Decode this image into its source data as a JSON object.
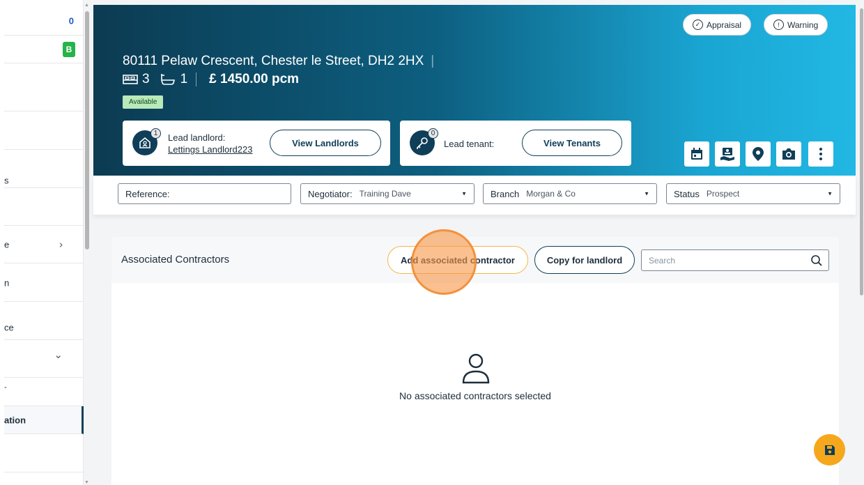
{
  "sidebar": {
    "items": [
      {
        "label": "",
        "count": "0"
      },
      {
        "label": "",
        "badge": "B"
      },
      {
        "label": ""
      },
      {
        "label": ""
      },
      {
        "label": "s"
      },
      {
        "label": "",
        "chevron": "›"
      },
      {
        "label": "e"
      },
      {
        "label": "n"
      },
      {
        "label": "ce",
        "chevron": "⌄"
      },
      {
        "label": "-"
      },
      {
        "label": "ation"
      },
      {
        "label": ""
      }
    ]
  },
  "header": {
    "appraisal_label": "Appraisal",
    "warning_label": "Warning",
    "address": "80111 Pelaw Crescent, Chester le Street, DH2 2HX",
    "bedrooms": "3",
    "bathrooms": "1",
    "price": "£ 1450.00 pcm",
    "status_badge": "Available",
    "landlord": {
      "count": "1",
      "label": "Lead landlord:",
      "name": "Lettings Landlord223",
      "button": "View Landlords"
    },
    "tenant": {
      "count": "0",
      "label": "Lead tenant:",
      "button": "View Tenants"
    },
    "tools": [
      "calendar-icon",
      "contact-icon",
      "location-pin-icon",
      "camera-icon",
      "more-vertical-icon"
    ]
  },
  "filters": {
    "reference_label": "Reference:",
    "reference_value": "",
    "negotiator_label": "Negotiator:",
    "negotiator_value": "Training Dave",
    "branch_label": "Branch",
    "branch_value": "Morgan & Co",
    "status_label": "Status",
    "status_value": "Prospect"
  },
  "contractors": {
    "title": "Associated Contractors",
    "add_button": "Add associated contractor",
    "copy_button": "Copy for landlord",
    "search_placeholder": "Search",
    "empty_message": "No associated contractors selected"
  },
  "colors": {
    "primary": "#0f3e58",
    "accent": "#f6a81c",
    "available": "#b9eab9"
  }
}
